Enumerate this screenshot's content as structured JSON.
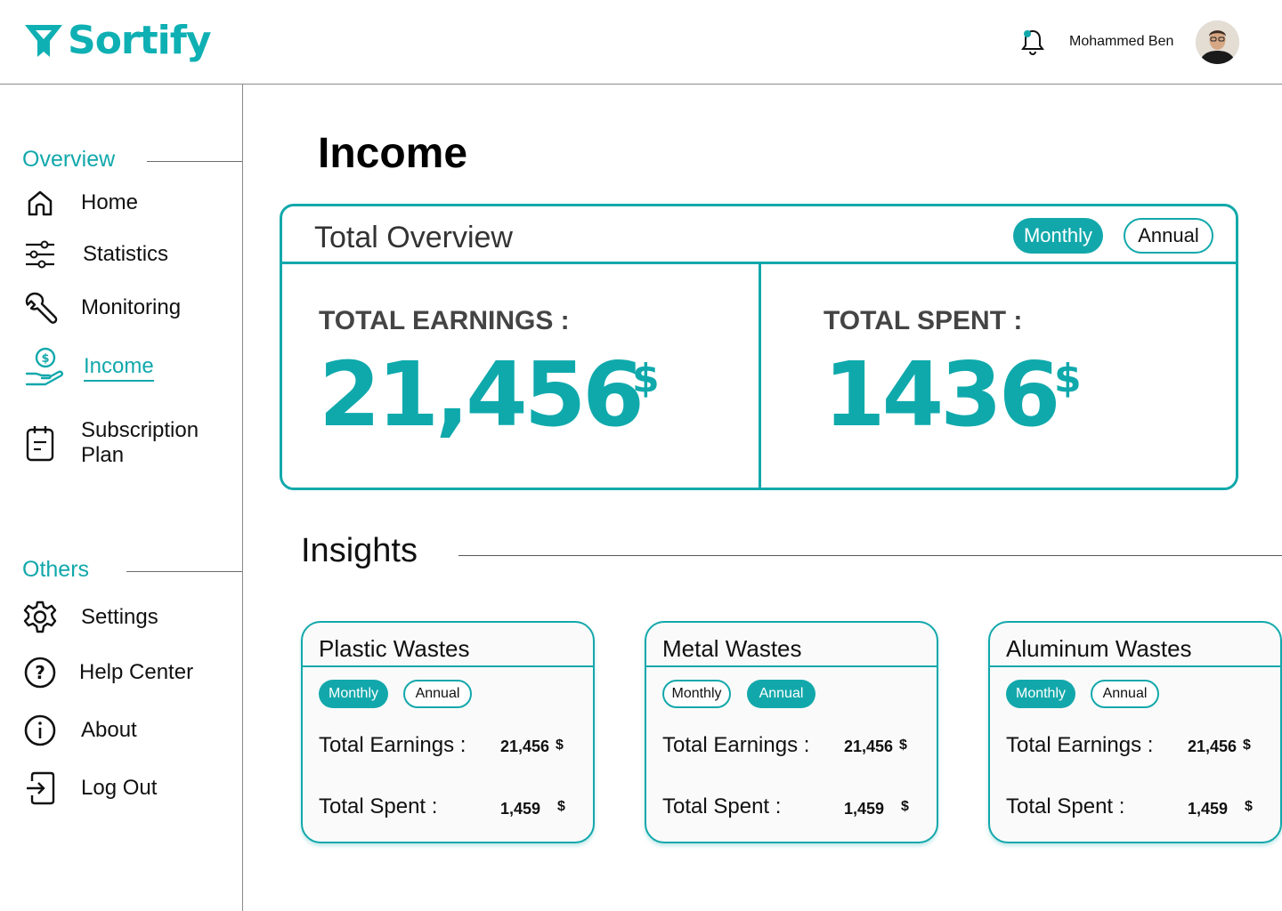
{
  "header": {
    "logo_text": "Sortify",
    "user_name": "Mohammed Ben"
  },
  "sidebar": {
    "overview_title": "Overview",
    "others_title": "Others",
    "items": [
      {
        "label": "Home",
        "icon": "home-icon"
      },
      {
        "label": "Statistics",
        "icon": "sliders-icon"
      },
      {
        "label": "Monitoring",
        "icon": "wrench-icon"
      },
      {
        "label": "Income",
        "icon": "income-icon",
        "active": true
      },
      {
        "label": "Subscription Plan",
        "icon": "clipboard-icon"
      }
    ],
    "others": [
      {
        "label": "Settings",
        "icon": "gear-icon"
      },
      {
        "label": "Help Center",
        "icon": "help-icon"
      },
      {
        "label": "About",
        "icon": "info-icon"
      },
      {
        "label": "Log Out",
        "icon": "logout-icon"
      }
    ]
  },
  "main": {
    "title": "Income",
    "overview": {
      "title": "Total Overview",
      "toggle_monthly": "Monthly",
      "toggle_annual": "Annual",
      "selected": "Monthly",
      "earnings_label": "TOTAL EARNINGS :",
      "earnings_value": "21,456",
      "spent_label": "TOTAL SPENT :",
      "spent_value": "1436",
      "unit": "$"
    },
    "insights_title": "Insights",
    "cards": [
      {
        "title": "Plastic Wastes",
        "monthly": "Monthly",
        "annual": "Annual",
        "selected": "Monthly",
        "earnings_label": "Total Earnings :",
        "earnings_value": "21,456",
        "spent_label": "Total Spent :",
        "spent_value": "1,459",
        "unit": "$"
      },
      {
        "title": "Metal Wastes",
        "monthly": "Monthly",
        "annual": "Annual",
        "selected": "Annual",
        "earnings_label": "Total Earnings :",
        "earnings_value": "21,456",
        "spent_label": "Total Spent :",
        "spent_value": "1,459",
        "unit": "$"
      },
      {
        "title": "Aluminum Wastes",
        "monthly": "Monthly",
        "annual": "Annual",
        "selected": "Monthly",
        "earnings_label": "Total Earnings :",
        "earnings_value": "21,456",
        "spent_label": "Total Spent :",
        "spent_value": "1,459",
        "unit": "$"
      }
    ]
  },
  "colors": {
    "accent": "#12a8ab",
    "text": "#111111",
    "divider": "#8a8a8a"
  }
}
